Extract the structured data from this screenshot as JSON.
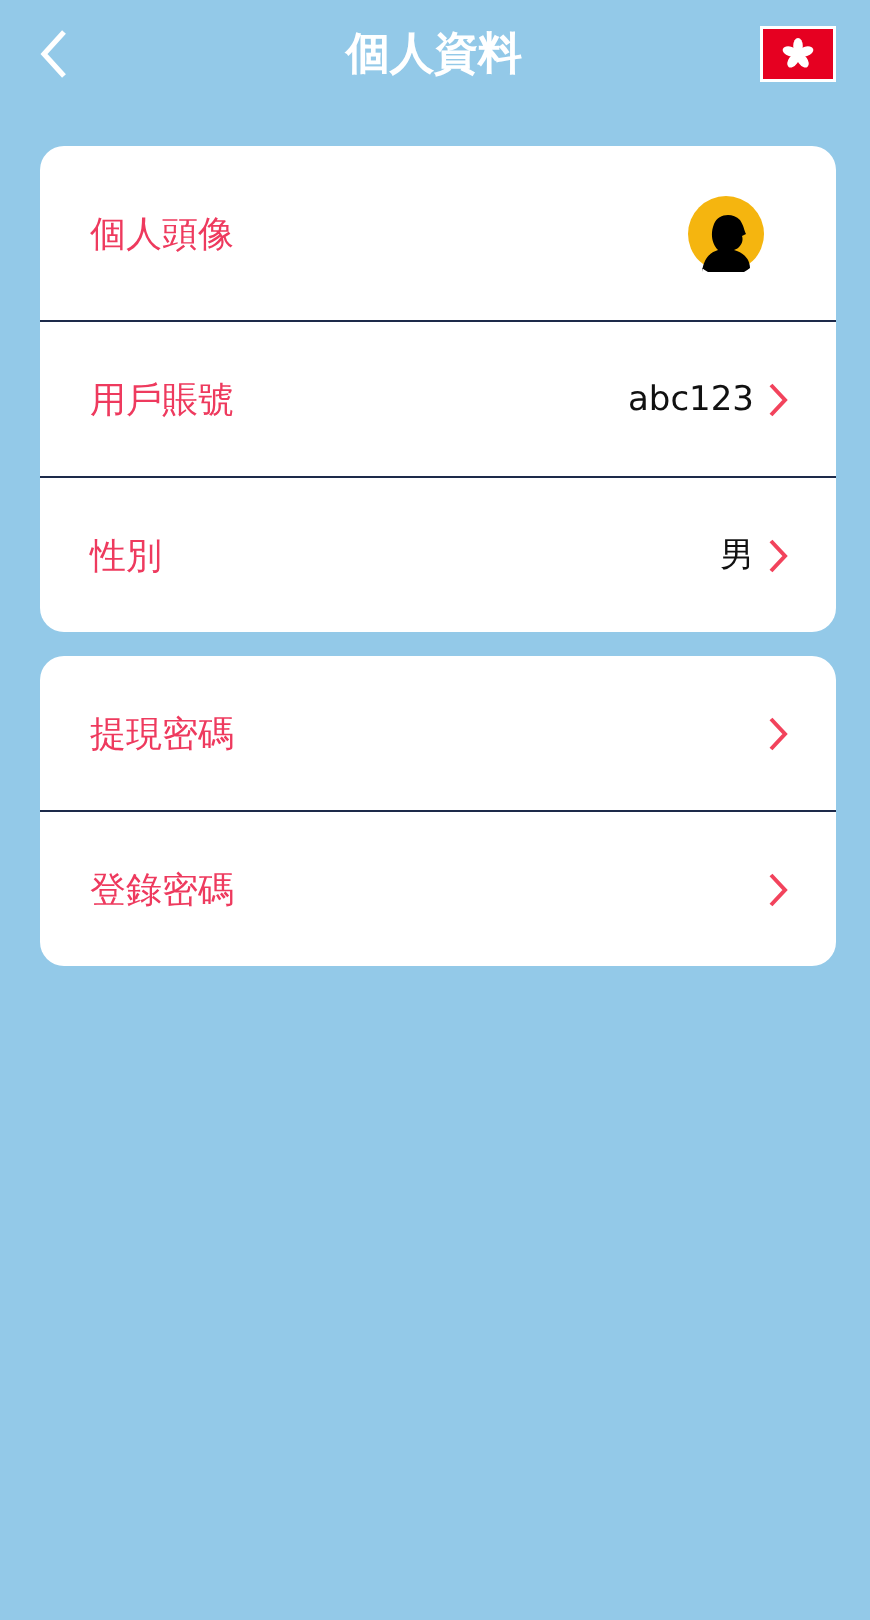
{
  "header": {
    "title": "個人資料"
  },
  "groups": [
    {
      "rows": [
        {
          "kind": "avatar",
          "label": "個人頭像"
        },
        {
          "kind": "value",
          "label": "用戶賬號",
          "value": "abc123"
        },
        {
          "kind": "value",
          "label": "性別",
          "value": "男"
        }
      ]
    },
    {
      "rows": [
        {
          "kind": "link",
          "label": "提現密碼"
        },
        {
          "kind": "link",
          "label": "登錄密碼"
        }
      ]
    }
  ]
}
